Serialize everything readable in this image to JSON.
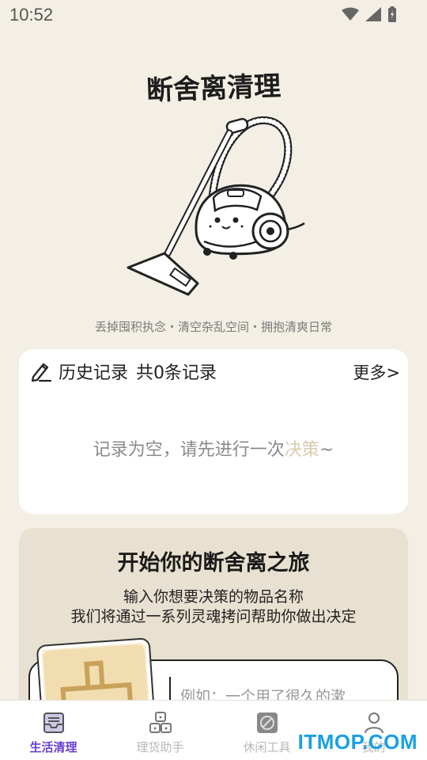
{
  "status_bar": {
    "time": "10:52"
  },
  "header": {
    "title": "断舍离清理",
    "tagline": "丢掉囤积执念・清空杂乱空间・拥抱清爽日常"
  },
  "history": {
    "title": "历史记录",
    "count": "共0条记录",
    "more": "更多>",
    "empty_prefix": "记录为空，请先进行一次",
    "empty_highlight": "决策",
    "empty_suffix": "~"
  },
  "journey": {
    "title": "开始你的断舍离之旅",
    "desc_line1": "输入你想要决策的物品名称",
    "desc_line2": "我们将通过一系列灵魂拷问帮助你做出决定",
    "input_placeholder": "例如：一个用了很久的漱"
  },
  "nav": {
    "items": [
      {
        "label": "生活清理",
        "icon": "inbox-icon",
        "active": true
      },
      {
        "label": "理货助手",
        "icon": "boxes-icon",
        "active": false
      },
      {
        "label": "休闲工具",
        "icon": "tools-icon",
        "active": false
      },
      {
        "label": "我的",
        "icon": "user-icon",
        "active": false
      }
    ]
  },
  "watermark": "ITMOP.COM",
  "colors": {
    "background": "#f3efe4",
    "accent": "#6b3fd1",
    "card": "#ffffff",
    "journey_card": "#e8e0d0",
    "highlight": "#d9cbb0"
  }
}
